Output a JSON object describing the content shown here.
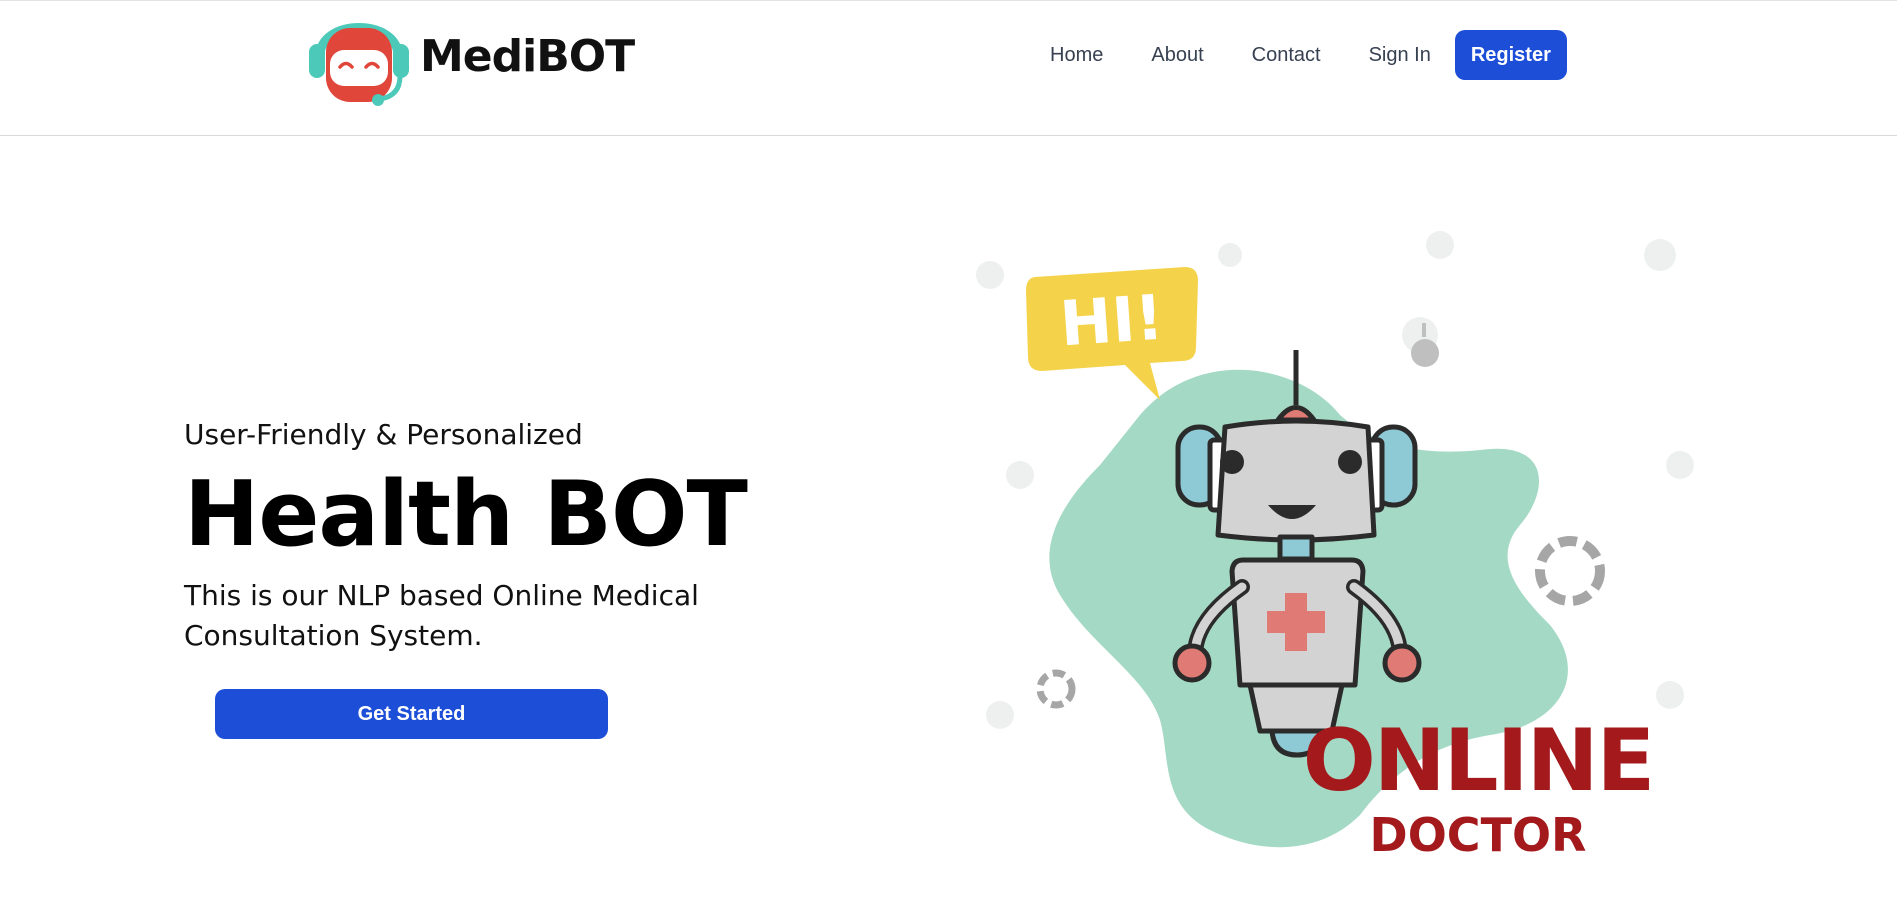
{
  "header": {
    "brand": "MediBOT",
    "nav": [
      "Home",
      "About",
      "Contact",
      "Sign In"
    ],
    "register_label": "Register"
  },
  "hero": {
    "subtitle": "User-Friendly & Personalized",
    "title": "Health BOT",
    "description": "This is our NLP based Online Medical Consultation System.",
    "cta_label": "Get Started"
  },
  "illustration": {
    "speech_text": "HI!",
    "line1": "ONLINE",
    "line2": "DOCTOR"
  },
  "colors": {
    "accent": "#1d4ed8",
    "logo_headset": "#4cc9b8",
    "logo_face": "#e0463a",
    "blob": "#a4d9c5",
    "speech": "#f4d34a",
    "online_text": "#a3191c",
    "cross": "#e07a75"
  },
  "icons": [
    "robot-headset-logo-icon",
    "robot-doctor-illustration"
  ]
}
